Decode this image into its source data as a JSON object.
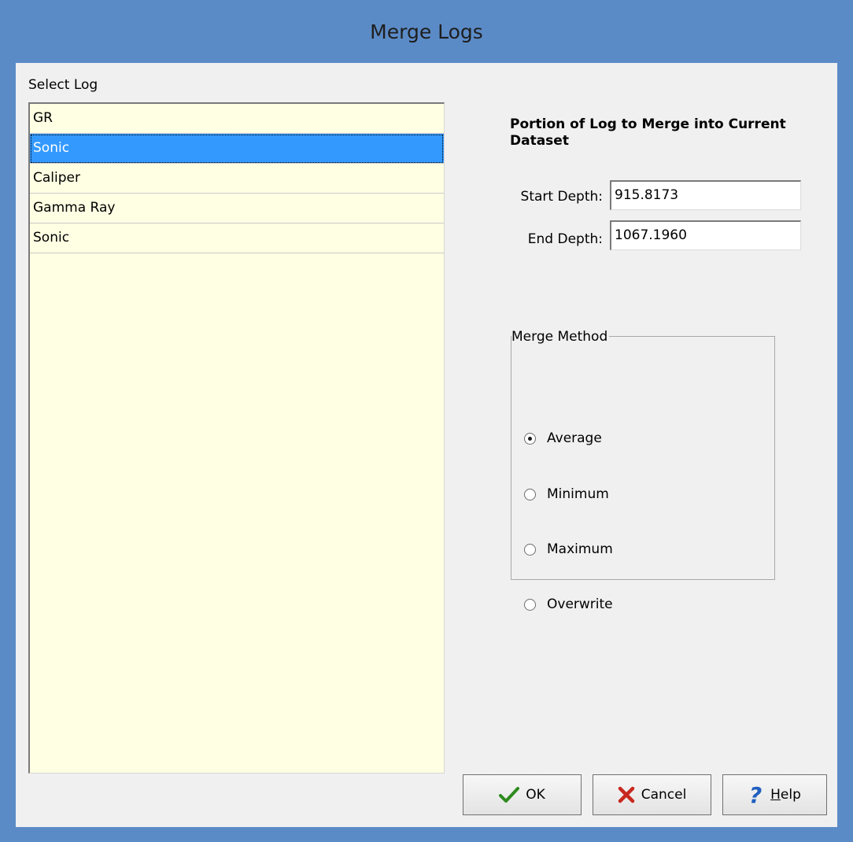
{
  "window": {
    "title": "Merge Logs"
  },
  "select_log": {
    "label": "Select Log",
    "items": [
      "GR",
      "Sonic",
      "Caliper",
      "Gamma Ray",
      "Sonic"
    ],
    "selected_index": 1
  },
  "portion": {
    "title": "Portion of Log to Merge into Current Dataset",
    "start_label": "Start Depth:",
    "start_value": "915.8173",
    "end_label": "End Depth:",
    "end_value": "1067.1960"
  },
  "merge_method": {
    "legend": "Merge Method",
    "options": [
      "Average",
      "Minimum",
      "Maximum",
      "Overwrite"
    ],
    "selected": "Average"
  },
  "buttons": {
    "ok": "OK",
    "cancel": "Cancel",
    "help_first": "H",
    "help_rest": "elp"
  },
  "colors": {
    "titlebar": "#5b8bc7",
    "list_background": "#ffffe3",
    "selection": "#3399ff",
    "ok_check": "#2e8b1e",
    "cancel_x": "#c8281e",
    "help_q": "#1f5fc0"
  },
  "icons": {
    "ok": "checkmark-icon",
    "cancel": "x-icon",
    "help": "question-mark-icon"
  }
}
